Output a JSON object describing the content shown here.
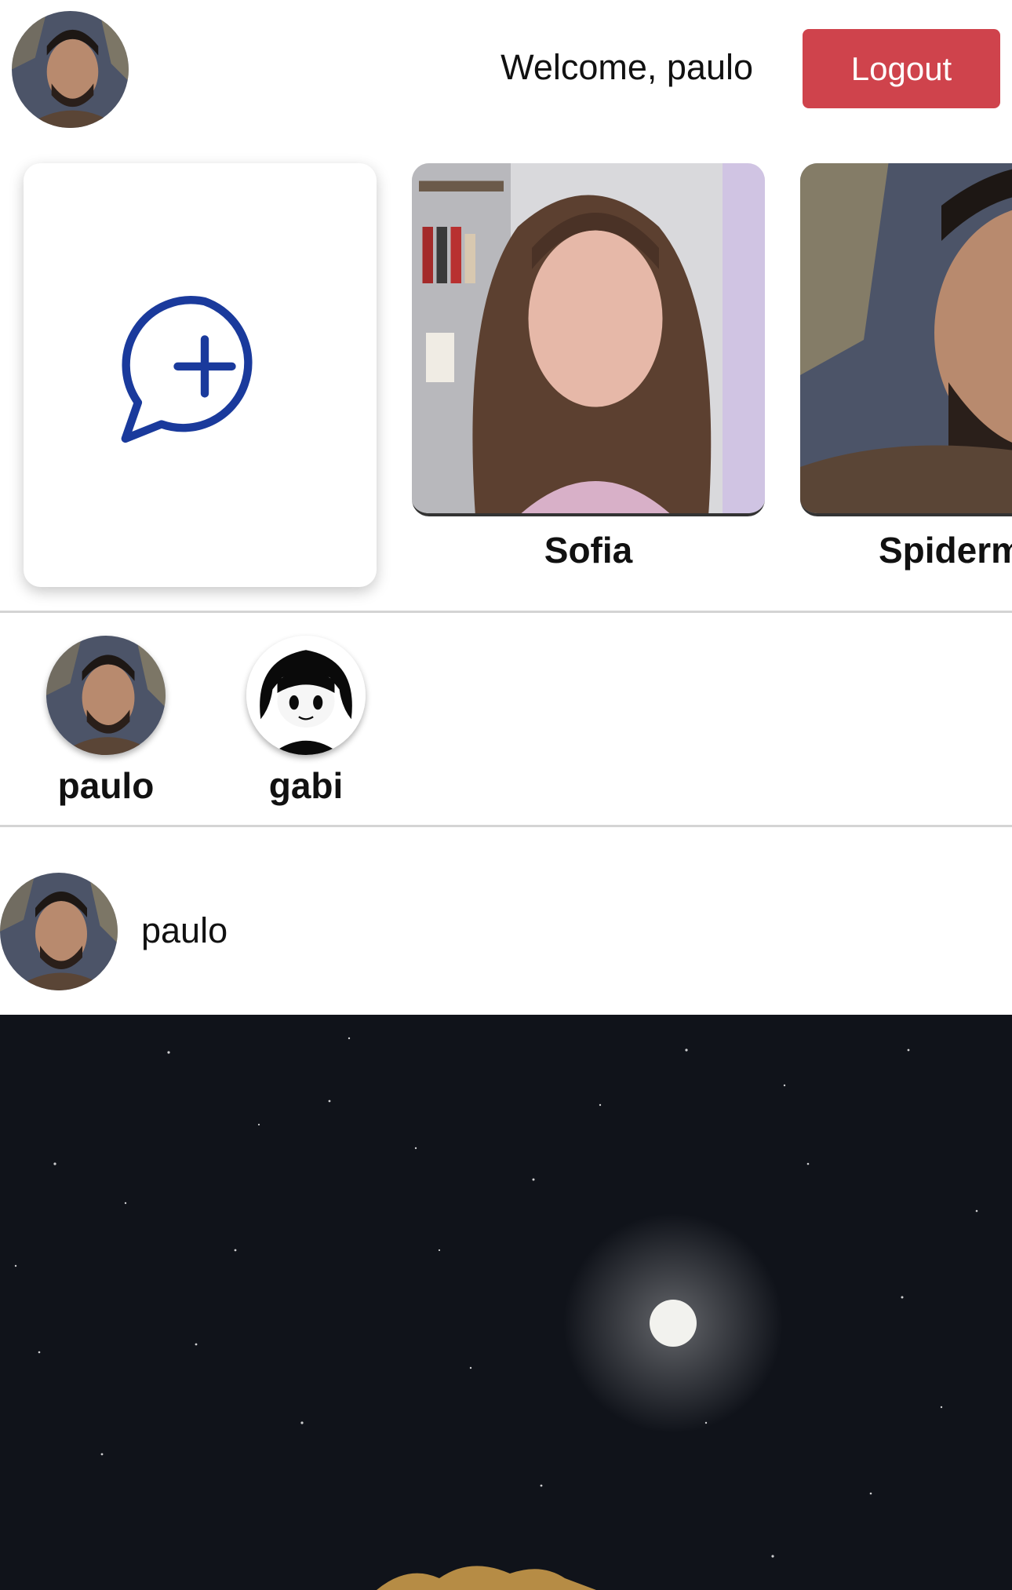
{
  "header": {
    "avatar_icon": "user-avatar-photo",
    "welcome_text": "Welcome, paulo",
    "logout_label": "Logout",
    "logout_color": "#cf434c"
  },
  "carousel": {
    "new_chat_icon": "chat-plus-icon",
    "icon_color": "#1a3a9c",
    "characters": [
      {
        "name": "Sofia"
      },
      {
        "name": "Spiderm"
      }
    ]
  },
  "users": [
    {
      "name": "paulo"
    },
    {
      "name": "gabi"
    }
  ],
  "post": {
    "author": "paulo",
    "image_icon": "night-sky-moon-image"
  }
}
